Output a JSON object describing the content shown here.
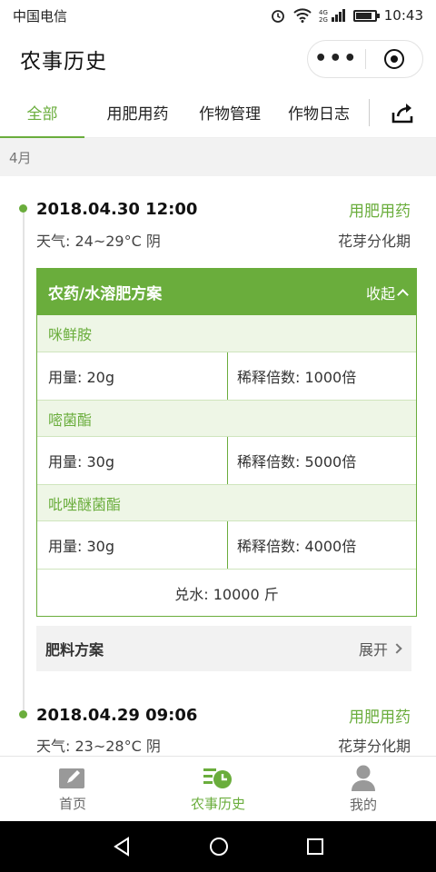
{
  "status_bar": {
    "carrier": "中国电信",
    "time": "10:43",
    "battery_level": 0.85
  },
  "app": {
    "title": "农事历史"
  },
  "tabs": [
    {
      "label": "全部",
      "active": true
    },
    {
      "label": "用肥用药",
      "active": false
    },
    {
      "label": "作物管理",
      "active": false
    },
    {
      "label": "作物日志",
      "active": false
    }
  ],
  "month": "4月",
  "records": [
    {
      "datetime": "2018.04.30 12:00",
      "type": "用肥用药",
      "weather": "天气: 24~29°C 阴",
      "stage": "花芽分化期",
      "plan": {
        "title": "农药/水溶肥方案",
        "toggle_label": "收起",
        "items": [
          {
            "name": "咪鲜胺",
            "dosage": "用量: 20g",
            "dilution": "稀释倍数: 1000倍"
          },
          {
            "name": "嘧菌酯",
            "dosage": "用量: 30g",
            "dilution": "稀释倍数: 5000倍"
          },
          {
            "name": "吡唑醚菌酯",
            "dosage": "用量: 30g",
            "dilution": "稀释倍数: 4000倍"
          }
        ],
        "water": "兑水: 10000 斤"
      },
      "fertilizer": {
        "title": "肥料方案",
        "toggle_label": "展开"
      }
    },
    {
      "datetime": "2018.04.29 09:06",
      "type": "用肥用药",
      "weather": "天气: 23~28°C 阴",
      "stage": "花芽分化期"
    }
  ],
  "bottom_nav": [
    {
      "label": "首页",
      "icon": "edit-icon",
      "active": false
    },
    {
      "label": "农事历史",
      "icon": "history-icon",
      "active": true
    },
    {
      "label": "我的",
      "icon": "user-icon",
      "active": false
    }
  ],
  "colors": {
    "accent": "#6aad3c",
    "accent_light": "#eef6e6"
  }
}
